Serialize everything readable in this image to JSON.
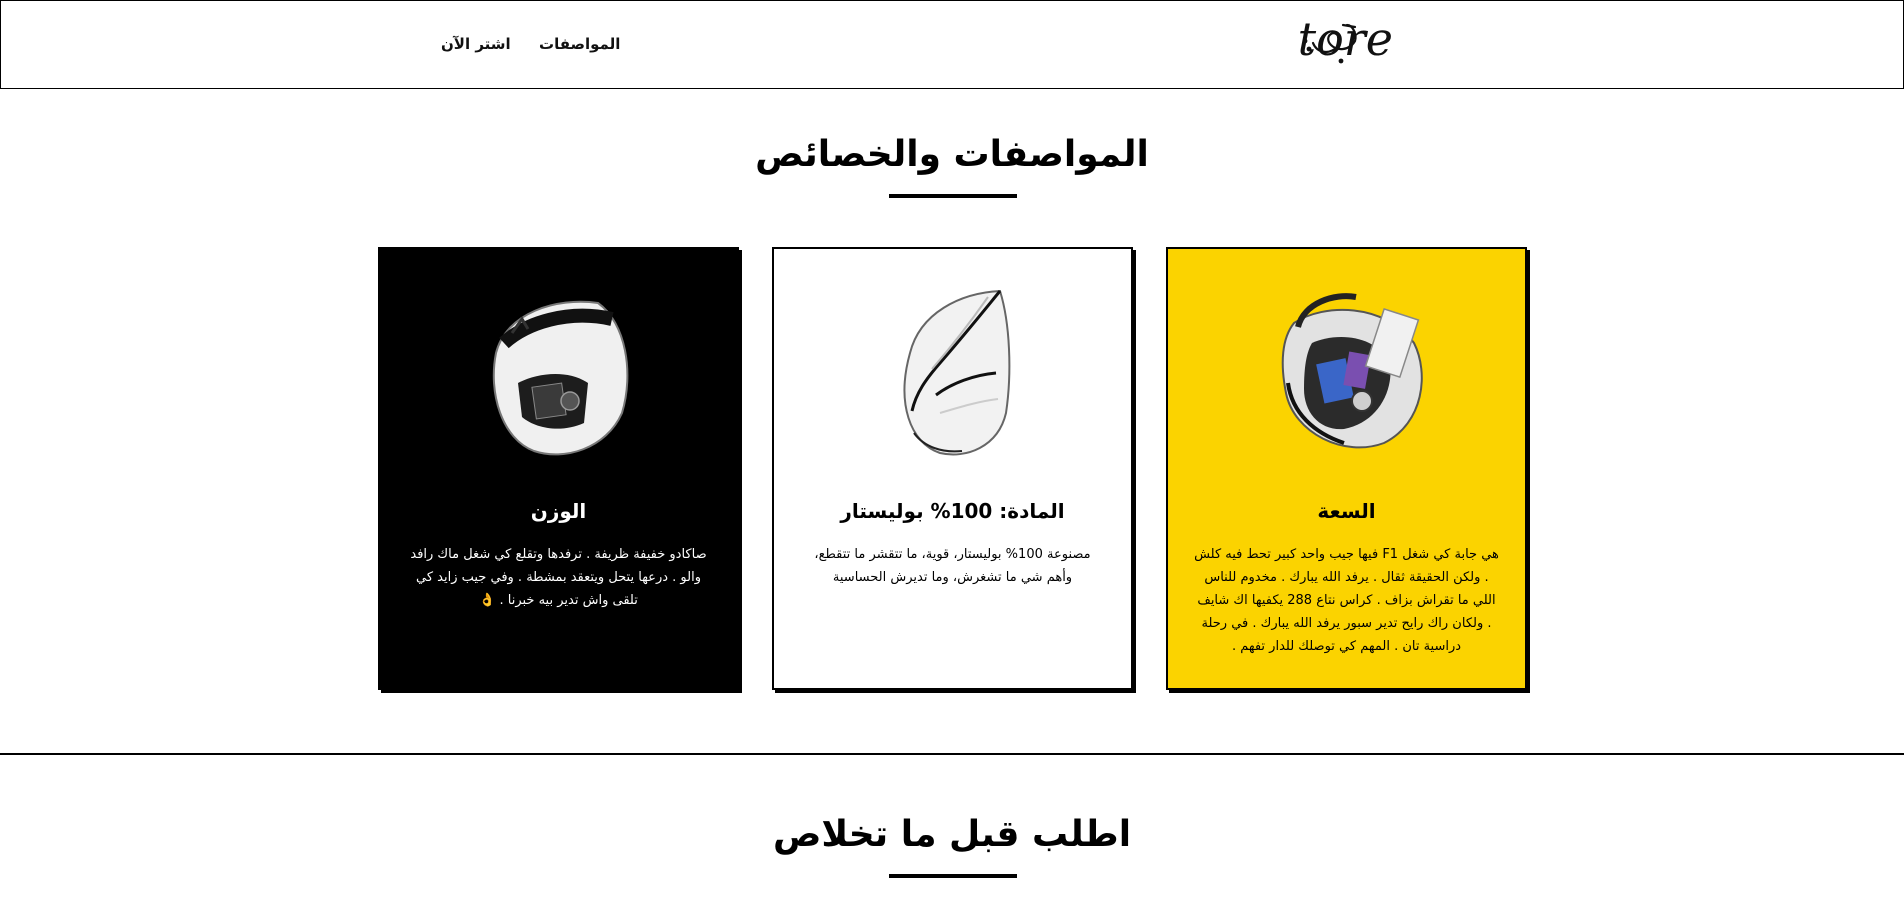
{
  "header": {
    "logo_text": "tore",
    "nav": {
      "specs": "المواصفات",
      "buy_now": "اشتر الآن"
    }
  },
  "specs_section": {
    "title": "المواصفات والخصائص",
    "cards": [
      {
        "title": "السعة",
        "text": "هي جابة كي شغل F1 فيها جيب واحد كبير تحط فيه كلش . ولكن الحقيقة ثقال . يرفد الله يبارك . مخدوم للناس اللي ما تقراش بزاف . كراس نتاع 288 يكفيها اك شايف . ولكان راك رايح تدير سبور يرفد الله يبارك . في رحلة دراسية تان . المهم كي توصلك للدار تفهم .",
        "background": "#fbd300"
      },
      {
        "title": "المادة: 100% بوليستار",
        "text": "مصنوعة 100% بوليستار، قوية، ما تتقشر ما تتقطع، وأهم شي ما تشغرش، وما تديرش الحساسية",
        "background": "#ffffff"
      },
      {
        "title": "الوزن",
        "text": "صاكادو خفيفة ظريفة . ترفدها وتقلع كي شغل ماك رافد والو . درعها يتحل ويتعقد بمشطة . وفي جيب زايد كي تلقى واش تدير بيه خبرنا . 👌",
        "background": "#000000"
      }
    ]
  },
  "order_section": {
    "title": "اطلب قبل ما تخلاص"
  },
  "colors": {
    "accent_yellow": "#fbd300",
    "text": "#000000",
    "background": "#ffffff"
  },
  "icons": [
    "bag-yellow-card-image",
    "bag-white-card-image",
    "bag-black-card-image"
  ]
}
